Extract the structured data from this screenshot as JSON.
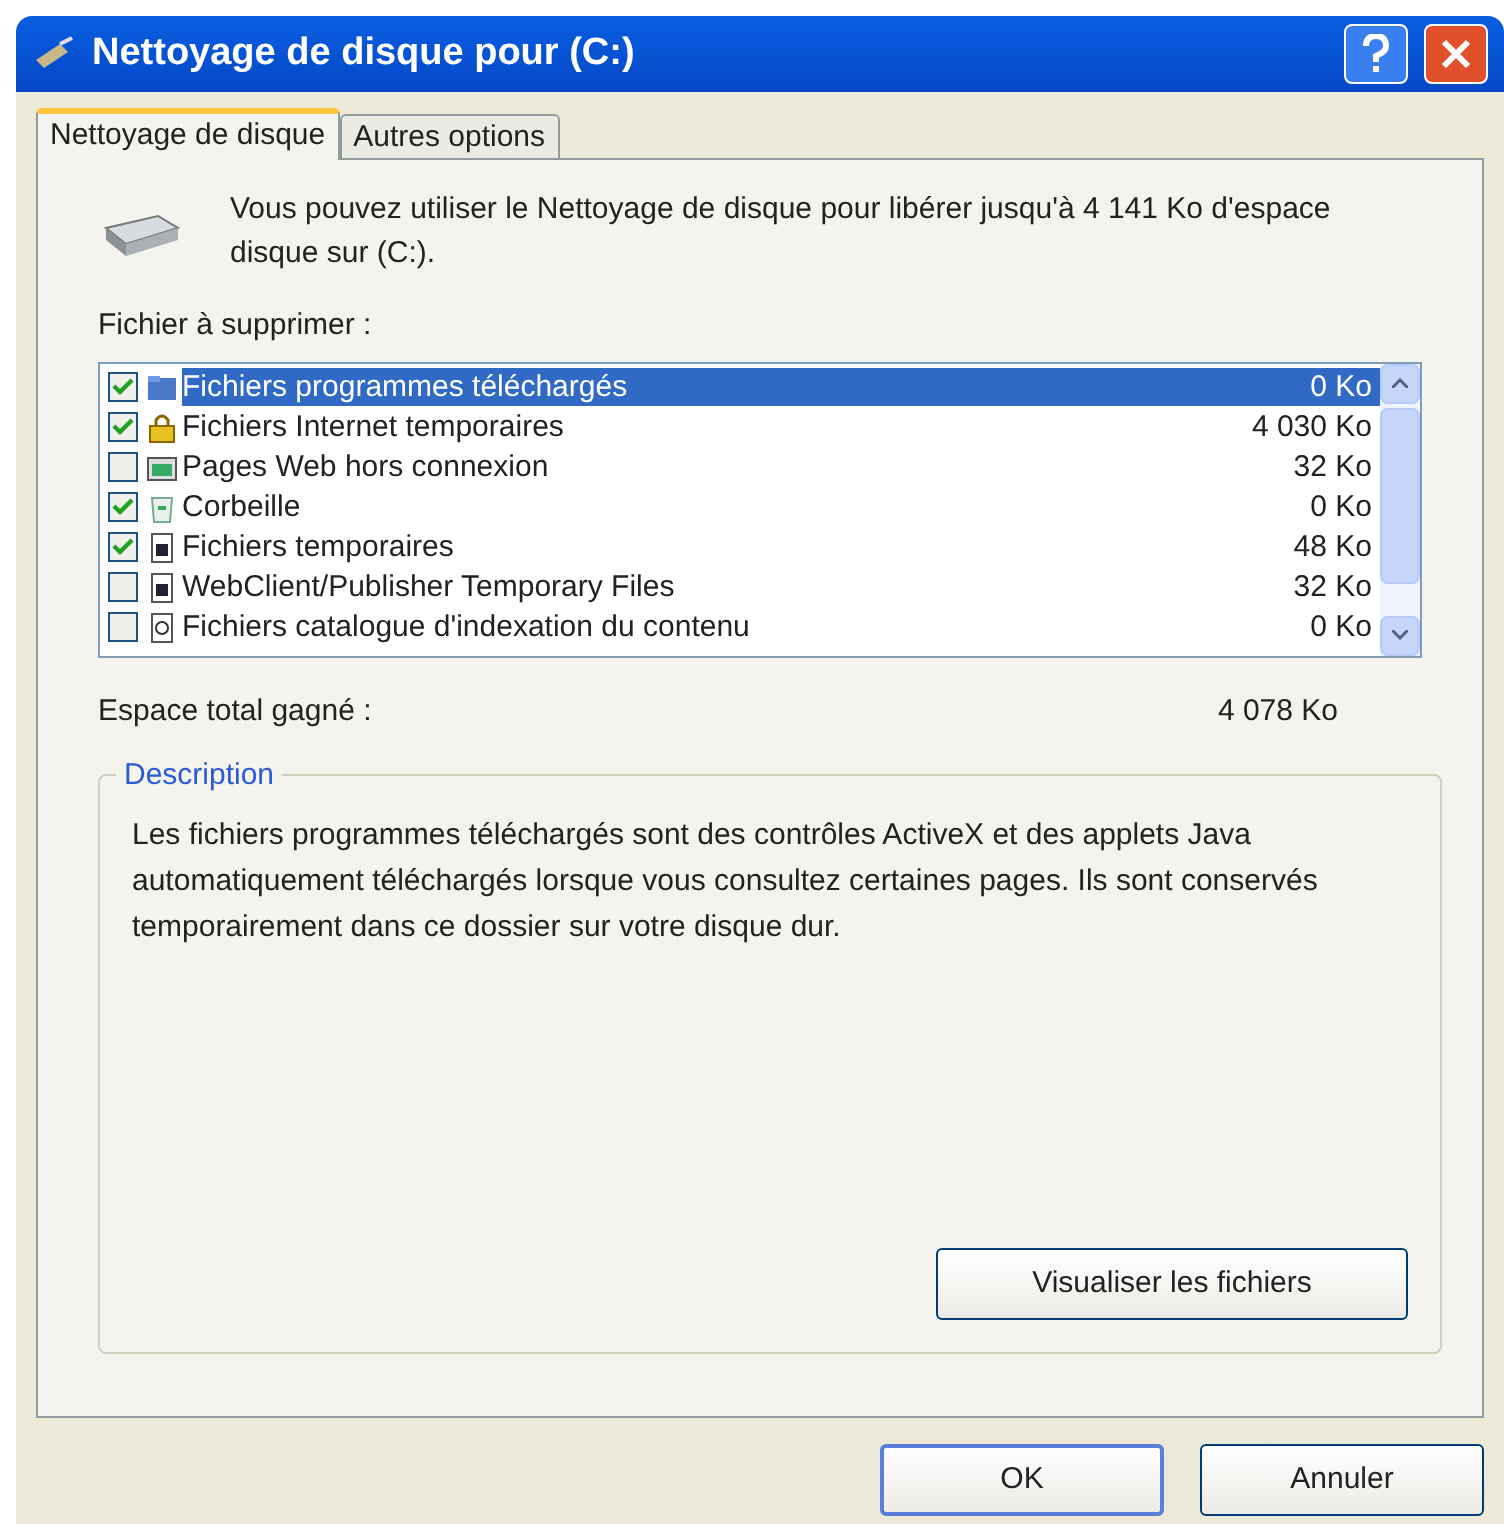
{
  "window": {
    "title": "Nettoyage de disque pour  (C:)"
  },
  "tabs": [
    {
      "label": "Nettoyage de disque",
      "selected": true
    },
    {
      "label": "Autres options",
      "selected": false
    }
  ],
  "intro": "Vous pouvez utiliser le Nettoyage de disque pour libérer jusqu'à 4 141 Ko d'espace disque sur  (C:).",
  "files_label": "Fichier à supprimer :",
  "files": [
    {
      "name": "Fichiers programmes téléchargés",
      "size": "0 Ko",
      "checked": true,
      "selected": true,
      "kind": "folder"
    },
    {
      "name": "Fichiers Internet temporaires",
      "size": "4 030 Ko",
      "checked": true,
      "selected": false,
      "kind": "lock"
    },
    {
      "name": "Pages Web hors connexion",
      "size": "32 Ko",
      "checked": false,
      "selected": false,
      "kind": "web"
    },
    {
      "name": "Corbeille",
      "size": "0 Ko",
      "checked": true,
      "selected": false,
      "kind": "bin"
    },
    {
      "name": "Fichiers temporaires",
      "size": "48 Ko",
      "checked": true,
      "selected": false,
      "kind": "file"
    },
    {
      "name": "WebClient/Publisher Temporary Files",
      "size": "32 Ko",
      "checked": false,
      "selected": false,
      "kind": "file"
    },
    {
      "name": "Fichiers catalogue d'indexation du contenu",
      "size": "0 Ko",
      "checked": false,
      "selected": false,
      "kind": "catalog"
    }
  ],
  "total_label": "Espace total gagné :",
  "total_value": "4 078 Ko",
  "description": {
    "title": "Description",
    "text": "Les fichiers programmes téléchargés sont des contrôles ActiveX et des applets Java automatiquement téléchargés lorsque vous consultez certaines pages. Ils sont conservés temporairement dans ce dossier sur votre disque dur.",
    "button": "Visualiser les fichiers"
  },
  "buttons": [
    "OK",
    "Annuler"
  ]
}
